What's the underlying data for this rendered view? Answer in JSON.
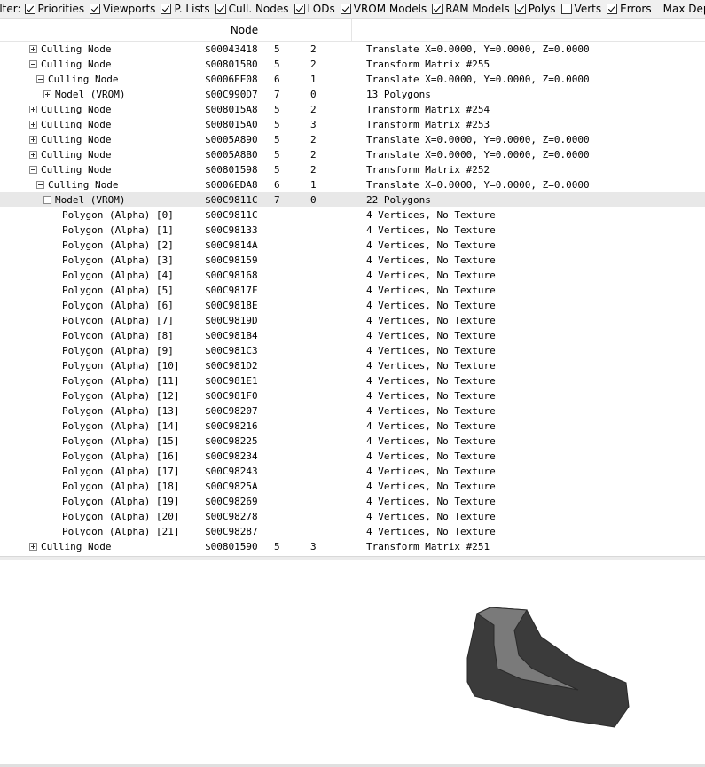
{
  "filter": {
    "label": "ilter:",
    "items": [
      {
        "label": "Priorities",
        "checked": true
      },
      {
        "label": "Viewports",
        "checked": true
      },
      {
        "label": "P. Lists",
        "checked": true
      },
      {
        "label": "Cull. Nodes",
        "checked": true
      },
      {
        "label": "LODs",
        "checked": true
      },
      {
        "label": "VROM Models",
        "checked": true
      },
      {
        "label": "RAM Models",
        "checked": true
      },
      {
        "label": "Polys",
        "checked": true
      },
      {
        "label": "Verts",
        "checked": false
      },
      {
        "label": "Errors",
        "checked": true
      }
    ],
    "max_depth_label": "Max Depth:"
  },
  "header": {
    "node_label": "Node"
  },
  "tree": {
    "rows": [
      {
        "name": "Culling Node",
        "depth": 0,
        "expander": "plus",
        "addr": "$00043418",
        "a": "5",
        "b": "2",
        "desc": "Translate X=0.0000, Y=0.0000, Z=0.0000"
      },
      {
        "name": "Culling Node",
        "depth": 0,
        "expander": "minus",
        "addr": "$008015B0",
        "a": "5",
        "b": "2",
        "desc": "Transform Matrix #255"
      },
      {
        "name": "Culling Node",
        "depth": 1,
        "expander": "minus",
        "addr": "$0006EE08",
        "a": "6",
        "b": "1",
        "desc": "Translate X=0.0000, Y=0.0000, Z=0.0000"
      },
      {
        "name": "Model (VROM)",
        "depth": 2,
        "expander": "plus",
        "addr": "$00C990D7",
        "a": "7",
        "b": "0",
        "desc": "13 Polygons"
      },
      {
        "name": "Culling Node",
        "depth": 0,
        "expander": "plus",
        "addr": "$008015A8",
        "a": "5",
        "b": "2",
        "desc": "Transform Matrix #254"
      },
      {
        "name": "Culling Node",
        "depth": 0,
        "expander": "plus",
        "addr": "$008015A0",
        "a": "5",
        "b": "3",
        "desc": "Transform Matrix #253"
      },
      {
        "name": "Culling Node",
        "depth": 0,
        "expander": "plus",
        "addr": "$0005A890",
        "a": "5",
        "b": "2",
        "desc": "Translate X=0.0000, Y=0.0000, Z=0.0000"
      },
      {
        "name": "Culling Node",
        "depth": 0,
        "expander": "plus",
        "addr": "$0005A8B0",
        "a": "5",
        "b": "2",
        "desc": "Translate X=0.0000, Y=0.0000, Z=0.0000"
      },
      {
        "name": "Culling Node",
        "depth": 0,
        "expander": "minus",
        "addr": "$00801598",
        "a": "5",
        "b": "2",
        "desc": "Transform Matrix #252"
      },
      {
        "name": "Culling Node",
        "depth": 1,
        "expander": "minus",
        "addr": "$0006EDA8",
        "a": "6",
        "b": "1",
        "desc": "Translate X=0.0000, Y=0.0000, Z=0.0000"
      },
      {
        "name": "Model (VROM)",
        "depth": 2,
        "expander": "minus",
        "addr": "$00C9811C",
        "a": "7",
        "b": "0",
        "desc": "22 Polygons",
        "selected": true
      },
      {
        "name": "Polygon (Alpha) [0]",
        "depth": 3,
        "expander": "",
        "addr": "$00C9811C",
        "a": "",
        "b": "",
        "desc": "4 Vertices, No Texture"
      },
      {
        "name": "Polygon (Alpha) [1]",
        "depth": 3,
        "expander": "",
        "addr": "$00C98133",
        "a": "",
        "b": "",
        "desc": "4 Vertices, No Texture"
      },
      {
        "name": "Polygon (Alpha) [2]",
        "depth": 3,
        "expander": "",
        "addr": "$00C9814A",
        "a": "",
        "b": "",
        "desc": "4 Vertices, No Texture"
      },
      {
        "name": "Polygon (Alpha) [3]",
        "depth": 3,
        "expander": "",
        "addr": "$00C98159",
        "a": "",
        "b": "",
        "desc": "4 Vertices, No Texture"
      },
      {
        "name": "Polygon (Alpha) [4]",
        "depth": 3,
        "expander": "",
        "addr": "$00C98168",
        "a": "",
        "b": "",
        "desc": "4 Vertices, No Texture"
      },
      {
        "name": "Polygon (Alpha) [5]",
        "depth": 3,
        "expander": "",
        "addr": "$00C9817F",
        "a": "",
        "b": "",
        "desc": "4 Vertices, No Texture"
      },
      {
        "name": "Polygon (Alpha) [6]",
        "depth": 3,
        "expander": "",
        "addr": "$00C9818E",
        "a": "",
        "b": "",
        "desc": "4 Vertices, No Texture"
      },
      {
        "name": "Polygon (Alpha) [7]",
        "depth": 3,
        "expander": "",
        "addr": "$00C9819D",
        "a": "",
        "b": "",
        "desc": "4 Vertices, No Texture"
      },
      {
        "name": "Polygon (Alpha) [8]",
        "depth": 3,
        "expander": "",
        "addr": "$00C981B4",
        "a": "",
        "b": "",
        "desc": "4 Vertices, No Texture"
      },
      {
        "name": "Polygon (Alpha) [9]",
        "depth": 3,
        "expander": "",
        "addr": "$00C981C3",
        "a": "",
        "b": "",
        "desc": "4 Vertices, No Texture"
      },
      {
        "name": "Polygon (Alpha) [10]",
        "depth": 3,
        "expander": "",
        "addr": "$00C981D2",
        "a": "",
        "b": "",
        "desc": "4 Vertices, No Texture"
      },
      {
        "name": "Polygon (Alpha) [11]",
        "depth": 3,
        "expander": "",
        "addr": "$00C981E1",
        "a": "",
        "b": "",
        "desc": "4 Vertices, No Texture"
      },
      {
        "name": "Polygon (Alpha) [12]",
        "depth": 3,
        "expander": "",
        "addr": "$00C981F0",
        "a": "",
        "b": "",
        "desc": "4 Vertices, No Texture"
      },
      {
        "name": "Polygon (Alpha) [13]",
        "depth": 3,
        "expander": "",
        "addr": "$00C98207",
        "a": "",
        "b": "",
        "desc": "4 Vertices, No Texture"
      },
      {
        "name": "Polygon (Alpha) [14]",
        "depth": 3,
        "expander": "",
        "addr": "$00C98216",
        "a": "",
        "b": "",
        "desc": "4 Vertices, No Texture"
      },
      {
        "name": "Polygon (Alpha) [15]",
        "depth": 3,
        "expander": "",
        "addr": "$00C98225",
        "a": "",
        "b": "",
        "desc": "4 Vertices, No Texture"
      },
      {
        "name": "Polygon (Alpha) [16]",
        "depth": 3,
        "expander": "",
        "addr": "$00C98234",
        "a": "",
        "b": "",
        "desc": "4 Vertices, No Texture"
      },
      {
        "name": "Polygon (Alpha) [17]",
        "depth": 3,
        "expander": "",
        "addr": "$00C98243",
        "a": "",
        "b": "",
        "desc": "4 Vertices, No Texture"
      },
      {
        "name": "Polygon (Alpha) [18]",
        "depth": 3,
        "expander": "",
        "addr": "$00C9825A",
        "a": "",
        "b": "",
        "desc": "4 Vertices, No Texture"
      },
      {
        "name": "Polygon (Alpha) [19]",
        "depth": 3,
        "expander": "",
        "addr": "$00C98269",
        "a": "",
        "b": "",
        "desc": "4 Vertices, No Texture"
      },
      {
        "name": "Polygon (Alpha) [20]",
        "depth": 3,
        "expander": "",
        "addr": "$00C98278",
        "a": "",
        "b": "",
        "desc": "4 Vertices, No Texture"
      },
      {
        "name": "Polygon (Alpha) [21]",
        "depth": 3,
        "expander": "",
        "addr": "$00C98287",
        "a": "",
        "b": "",
        "desc": "4 Vertices, No Texture"
      },
      {
        "name": "Culling Node",
        "depth": 0,
        "expander": "plus",
        "addr": "$00801590",
        "a": "5",
        "b": "3",
        "desc": "Transform Matrix #251"
      }
    ]
  },
  "viewport": {
    "colors": {
      "dark": "#3b3b3b",
      "light": "#7a7a7a",
      "edge": "#2a2a2a"
    }
  }
}
